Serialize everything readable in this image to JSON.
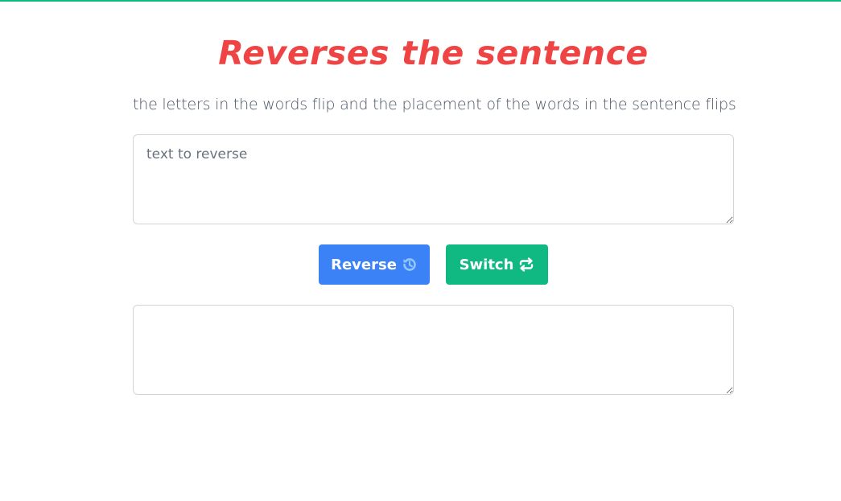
{
  "header": {
    "title": "Reverses the sentence",
    "subtitle": "the letters in the words flip and the placement of the words in the sentence flips"
  },
  "input": {
    "placeholder": "text to reverse",
    "value": ""
  },
  "output": {
    "value": ""
  },
  "buttons": {
    "reverse_label": "Reverse",
    "reverse_icon": "history-icon",
    "switch_label": "Switch",
    "switch_icon": "repeat-icon"
  },
  "colors": {
    "accent_top_bar": "#10b981",
    "title": "#ef4444",
    "reverse_button": "#3b82f6",
    "switch_button": "#10b981"
  }
}
